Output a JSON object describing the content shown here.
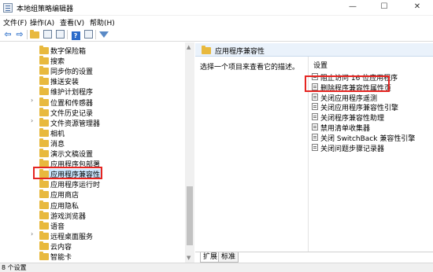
{
  "window": {
    "title": "本地组策略编辑器",
    "controls": {
      "minimize": "—",
      "maximize": "☐",
      "close": "✕"
    }
  },
  "menu": [
    "文件(F)",
    "操作(A)",
    "查看(V)",
    "帮助(H)"
  ],
  "toolbar": {
    "icons": [
      "back-arrow-icon",
      "forward-arrow-icon",
      "up-folder-icon",
      "show-hide-tree-icon",
      "export-list-icon",
      "help-icon",
      "properties-icon",
      "filter-icon"
    ],
    "back": "⇦",
    "forward": "⇨"
  },
  "tree": {
    "items": [
      {
        "label": "数字保险箱",
        "expandable": false
      },
      {
        "label": "搜索",
        "expandable": false
      },
      {
        "label": "同步你的设置",
        "expandable": false
      },
      {
        "label": "推送安装",
        "expandable": false
      },
      {
        "label": "维护计划程序",
        "expandable": false
      },
      {
        "label": "位置和传感器",
        "expandable": true
      },
      {
        "label": "文件历史记录",
        "expandable": false
      },
      {
        "label": "文件资源管理器",
        "expandable": true
      },
      {
        "label": "相机",
        "expandable": false
      },
      {
        "label": "消息",
        "expandable": false
      },
      {
        "label": "演示文稿设置",
        "expandable": false
      },
      {
        "label": "应用程序包部署",
        "expandable": false
      },
      {
        "label": "应用程序兼容性",
        "expandable": false,
        "selected": true
      },
      {
        "label": "应用程序运行时",
        "expandable": false
      },
      {
        "label": "应用商店",
        "expandable": false
      },
      {
        "label": "应用隐私",
        "expandable": false
      },
      {
        "label": "游戏浏览器",
        "expandable": false
      },
      {
        "label": "语音",
        "expandable": false
      },
      {
        "label": "远程桌面服务",
        "expandable": true
      },
      {
        "label": "云内容",
        "expandable": false
      },
      {
        "label": "智能卡",
        "expandable": false
      }
    ],
    "chevron": "›"
  },
  "right_pane": {
    "header": "应用程序兼容性",
    "description": "选择一个项目来查看它的描述。",
    "settings_header": "设置",
    "settings": [
      "阻止访问 16 位应用程序",
      "删除程序兼容性属性页",
      "关闭应用程序遥测",
      "关闭应用程序兼容性引擎",
      "关闭程序兼容性助理",
      "禁用清单收集器",
      "关闭 SwitchBack 兼容性引擎",
      "关闭问题步骤记录器"
    ]
  },
  "tabs": [
    "扩展",
    "标准"
  ],
  "status": "8 个设置",
  "colors": {
    "highlight": "#e52521",
    "selection": "#cce8ff",
    "folder": "#e8b93e"
  }
}
